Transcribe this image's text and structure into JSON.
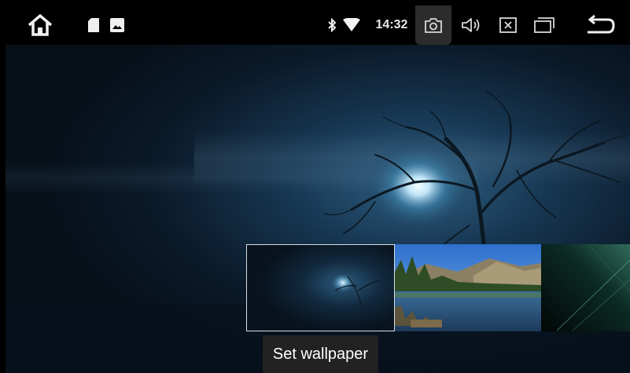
{
  "status_bar": {
    "time": "14:32",
    "icons": [
      "home-icon",
      "sd-card-icon",
      "image-icon",
      "bluetooth-icon",
      "wifi-icon",
      "screenshot-icon",
      "volume-icon",
      "close-box-icon",
      "recent-apps-icon",
      "back-icon"
    ]
  },
  "wallpaper_preview": {
    "scene": "moonlit-tree"
  },
  "thumbnails": [
    {
      "scene": "moonlit-tree",
      "selected": true
    },
    {
      "scene": "mountain-lake",
      "selected": false
    },
    {
      "scene": "green-light-streaks",
      "selected": false
    }
  ],
  "action": {
    "set_wallpaper_label": "Set wallpaper"
  },
  "colors": {
    "statusbar_bg": "#000000",
    "selected_border": "#d6dde4",
    "button_bg": "#222222"
  }
}
